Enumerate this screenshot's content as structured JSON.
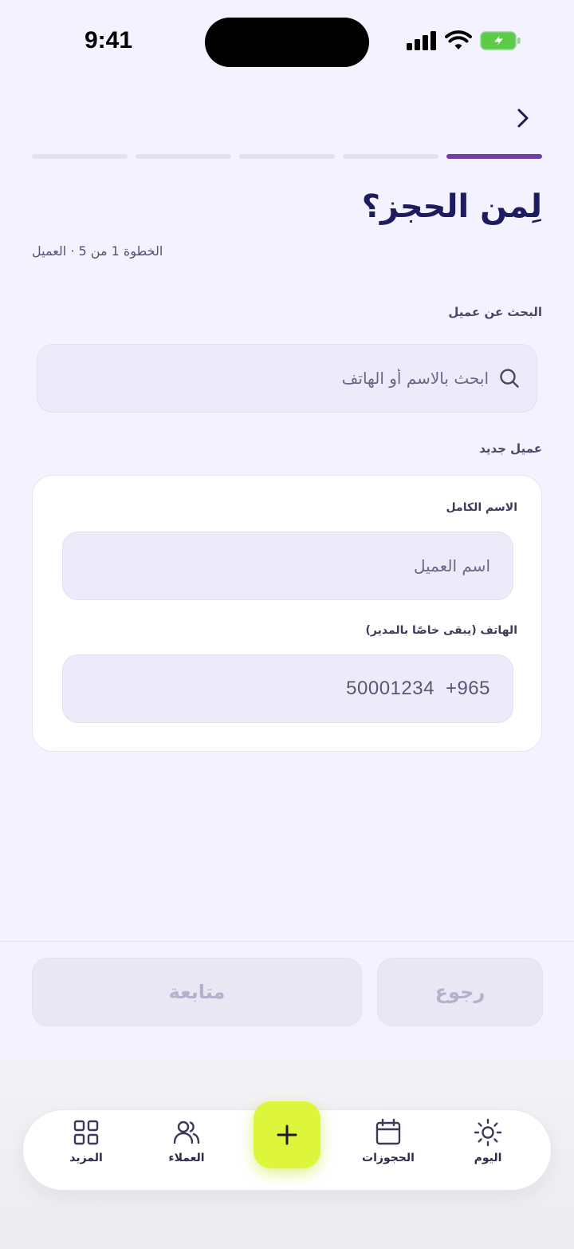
{
  "status_bar": {
    "time": "9:41"
  },
  "header": {
    "progress": {
      "total_steps": 5,
      "current_step": 1
    },
    "title": "لِمن الحجز؟",
    "subtitle": "الخطوة 1 من 5 · العميل"
  },
  "search": {
    "label": "البحث عن عميل",
    "placeholder": "ابحث بالاسم أو الهاتف",
    "value": ""
  },
  "new_client": {
    "label": "عميل جديد",
    "name_field": {
      "label": "الاسم الكامل",
      "placeholder": "اسم العميل",
      "value": ""
    },
    "phone_field": {
      "label": "الهاتف (يبقى خاصًا بالمدير)",
      "country_code": "+965",
      "placeholder": "50001234"
    }
  },
  "actions": {
    "continue_label": "متابعة",
    "back_label": "رجوع"
  },
  "tab_bar": {
    "items": [
      {
        "label": "اليوم",
        "icon": "sun-icon"
      },
      {
        "label": "الحجوزات",
        "icon": "calendar-icon"
      },
      {
        "label": "",
        "icon": "plus-icon"
      },
      {
        "label": "العملاء",
        "icon": "users-icon"
      },
      {
        "label": "المزيد",
        "icon": "grid-icon"
      }
    ]
  },
  "colors": {
    "background": "#F4F2FF",
    "progress_active": "#6E3FA8",
    "title": "#1E1B5E",
    "fab": "#DDF53A"
  }
}
